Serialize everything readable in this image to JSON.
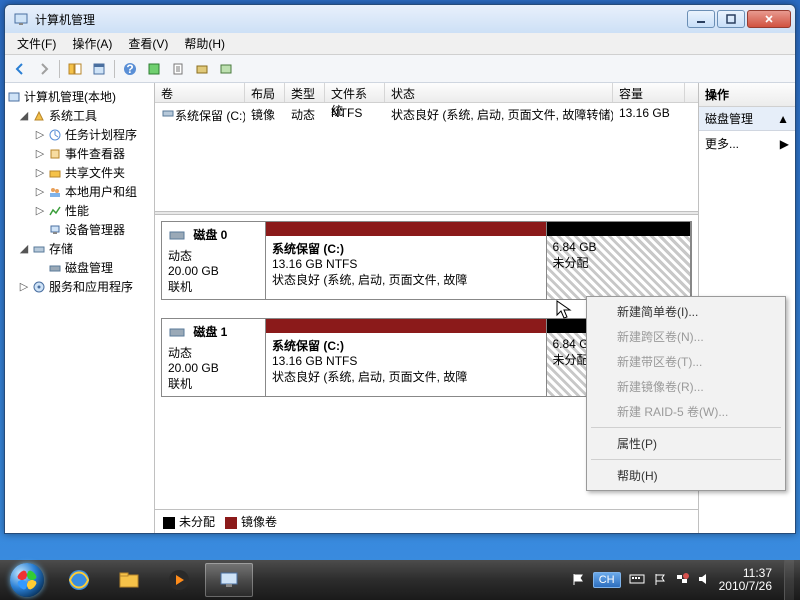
{
  "title": "计算机管理",
  "menus": {
    "file": "文件(F)",
    "action": "操作(A)",
    "view": "查看(V)",
    "help": "帮助(H)"
  },
  "tree": {
    "root": "计算机管理(本地)",
    "systools": "系统工具",
    "tasks": "任务计划程序",
    "events": "事件查看器",
    "shared": "共享文件夹",
    "users": "本地用户和组",
    "perf": "性能",
    "devmgr": "设备管理器",
    "storage": "存储",
    "diskmgmt": "磁盘管理",
    "services": "服务和应用程序"
  },
  "volcols": {
    "vol": "卷",
    "layout": "布局",
    "type": "类型",
    "fs": "文件系统",
    "status": "状态",
    "cap": "容量"
  },
  "volume": {
    "name": "系统保留 (C:)",
    "layout": "镜像",
    "type": "动态",
    "fs": "NTFS",
    "status": "状态良好 (系统, 启动, 页面文件, 故障转储)",
    "cap": "13.16 GB"
  },
  "disks": [
    {
      "title": "磁盘 0",
      "dyn": "动态",
      "size": "20.00 GB",
      "online": "联机",
      "p1_name": "系统保留  (C:)",
      "p1_sub": "13.16 GB NTFS",
      "p1_stat": "状态良好 (系统, 启动, 页面文件, 故障",
      "p2_size": "6.84 GB",
      "p2_stat": "未分配"
    },
    {
      "title": "磁盘 1",
      "dyn": "动态",
      "size": "20.00 GB",
      "online": "联机",
      "p1_name": "系统保留  (C:)",
      "p1_sub": "13.16 GB NTFS",
      "p1_stat": "状态良好 (系统, 启动, 页面文件, 故障",
      "p2_size": "6.84 GB",
      "p2_stat": "未分配"
    }
  ],
  "legend": {
    "un": "未分配",
    "mir": "镜像卷"
  },
  "actions": {
    "hdr": "操作",
    "diskmgmt": "磁盘管理",
    "more": "更多..."
  },
  "ctx": {
    "simple": "新建简单卷(I)...",
    "span": "新建跨区卷(N)...",
    "stripe": "新建带区卷(T)...",
    "mirror": "新建镜像卷(R)...",
    "raid5": "新建 RAID-5 卷(W)...",
    "props": "属性(P)",
    "help": "帮助(H)"
  },
  "tray": {
    "ime": "CH",
    "time": "11:37",
    "date": "2010/7/26"
  }
}
